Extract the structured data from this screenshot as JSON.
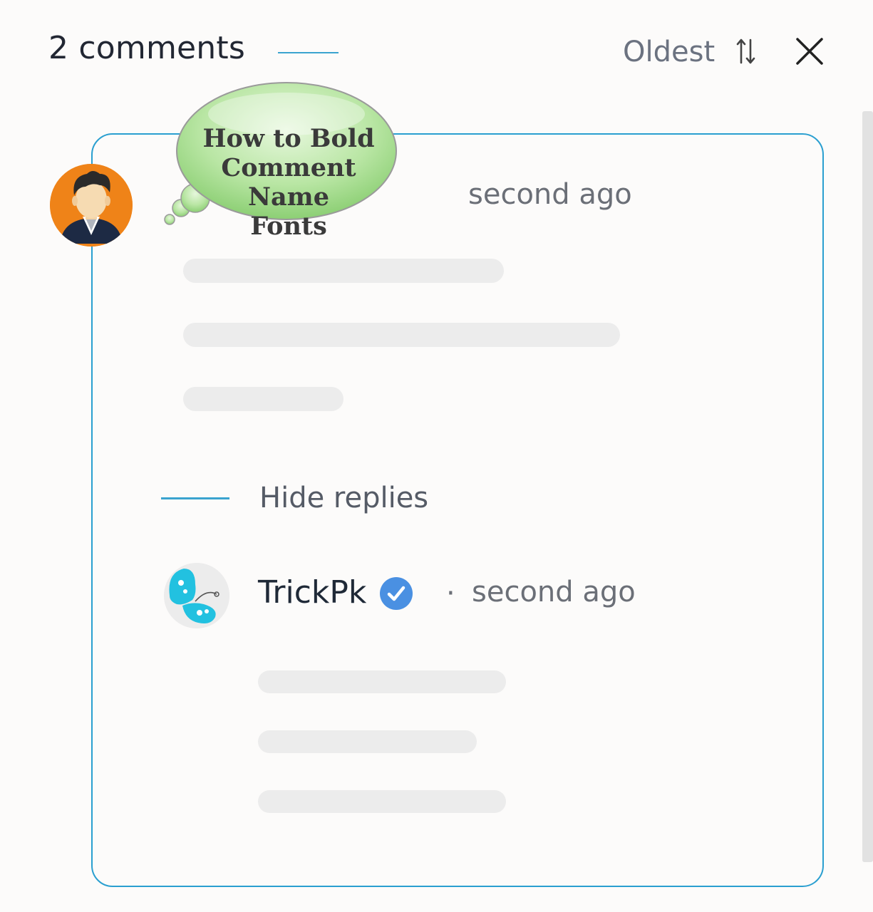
{
  "header": {
    "count_label": "2 comments",
    "sort_label": "Oldest",
    "sort_icon": "sort-arrows-icon",
    "close_icon": "close-icon"
  },
  "overlay": {
    "bubble_lines": [
      "How to Bold",
      "Comment Name",
      "Fonts"
    ]
  },
  "comment": {
    "avatar_icon": "user-avatar-icon",
    "time": "second ago"
  },
  "replies": {
    "toggle_label": "Hide replies"
  },
  "reply": {
    "avatar_icon": "butterfly-logo-icon",
    "author": "TrickPk",
    "badge_icon": "verified-badge-icon",
    "separator": "·",
    "time": "second ago"
  },
  "colors": {
    "accent": "#2a9fd0",
    "verified": "#4a90e2",
    "skeleton": "#ececec"
  }
}
